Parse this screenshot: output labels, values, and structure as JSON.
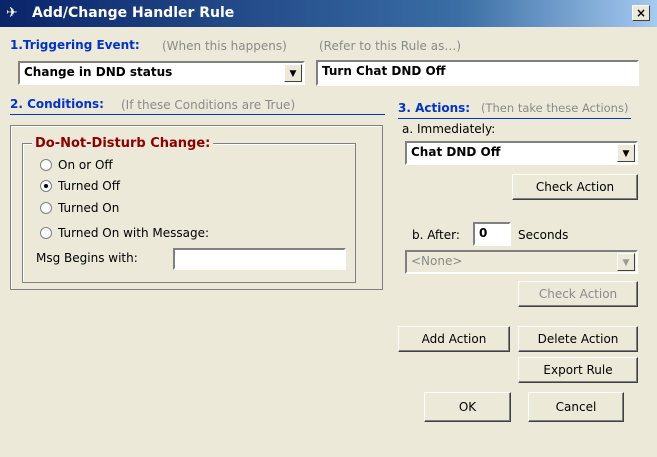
{
  "window": {
    "title": "Add/Change Handler Rule",
    "close_symbol": "×",
    "icon": "app-icon"
  },
  "triggering": {
    "title": "1.Triggering Event:",
    "hint": "(When this happens)",
    "selected": "Change in DND status",
    "refer_hint": "(Refer to this Rule as…)",
    "rule_name": "Turn Chat DND Off"
  },
  "conditions": {
    "title": "2. Conditions:",
    "hint": "(If these Conditions are True)",
    "group_title": "Do-Not-Disturb Change:",
    "options": [
      {
        "label": "On or Off",
        "checked": false
      },
      {
        "label": "Turned Off",
        "checked": true
      },
      {
        "label": "Turned On",
        "checked": false
      },
      {
        "label": "Turned On with Message:",
        "checked": false
      }
    ],
    "msg_label": "Msg Begins with:",
    "msg_value": ""
  },
  "actions": {
    "title": "3. Actions:",
    "hint": "(Then take these Actions)",
    "immediately_label": "a. Immediately:",
    "immediate_action": "Chat DND Off",
    "check_action": "Check Action",
    "after_label": "b. After:",
    "after_value": "0",
    "seconds_label": "Seconds",
    "after_action": "<None>",
    "check_action_2": "Check Action"
  },
  "buttons": {
    "add_action": "Add Action",
    "delete_action": "Delete Action",
    "export_rule": "Export Rule",
    "ok": "OK",
    "cancel": "Cancel"
  }
}
